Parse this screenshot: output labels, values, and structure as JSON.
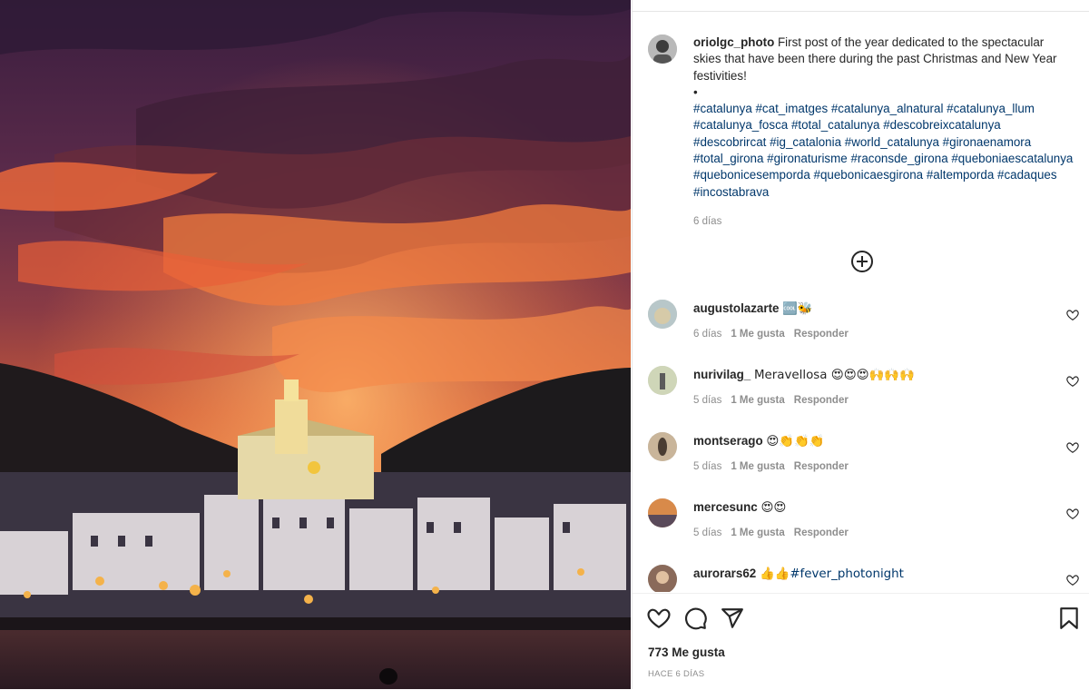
{
  "post": {
    "username": "oriolgc_photo",
    "caption": "First post of the year dedicated to the spectacular skies that have been there during the past Christmas and New Year festivities!",
    "bullet": "•",
    "hashtags": "#catalunya #cat_imatges #catalunya_alnatural #catalunya_llum #catalunya_fosca #total_catalunya #descobreixcatalunya #descobrircat #ig_catalonia #world_catalunya #gironaenamora #total_girona #gironaturisme #raconsde_girona #queboniaescatalunya #quebonicesemporda #quebonicaesgirona #altemporda #cadaques #incostabrava",
    "time": "6 días"
  },
  "comments": [
    {
      "user": "augustolazarte",
      "text": "🆒🐝",
      "time": "6 días",
      "likes": "1 Me gusta",
      "reply": "Responder"
    },
    {
      "user": "nurivilag_",
      "text": "Meravellosa 😍😍😍🙌🙌🙌",
      "time": "5 días",
      "likes": "1 Me gusta",
      "reply": "Responder"
    },
    {
      "user": "montserago",
      "text": "😍👏👏👏",
      "time": "5 días",
      "likes": "1 Me gusta",
      "reply": "Responder"
    },
    {
      "user": "mercesunc",
      "text": "😍😍",
      "time": "5 días",
      "likes": "1 Me gusta",
      "reply": "Responder"
    },
    {
      "user": "aurorars62",
      "text": "👍👍#fever_photonight",
      "time": "",
      "likes": "",
      "reply": ""
    }
  ],
  "footer": {
    "likes": "773 Me gusta",
    "ago": "HACE 6 DÍAS"
  },
  "colors": {
    "text": "#262626",
    "muted": "#8e8e8e",
    "hashtag": "#00376b",
    "border": "#efefef"
  },
  "icons": [
    "add-comment-icon",
    "heart-icon",
    "comment-icon",
    "share-icon",
    "bookmark-icon",
    "comment-like-heart-icon"
  ]
}
